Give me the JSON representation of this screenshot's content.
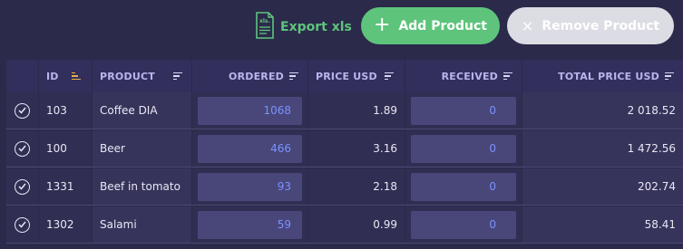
{
  "toolbar": {
    "export_label": "Export xls",
    "export_icon": "xls-file-icon",
    "export_icon_text": "xls.",
    "add_label": "Add Product",
    "add_icon": "+",
    "remove_label": "Remove Product",
    "remove_icon": "×"
  },
  "colors": {
    "background": "#2b2a4a",
    "accent_green": "#5ec47c",
    "disabled_button": "#dcdce4",
    "input_value": "#7a92ff",
    "sort_active": "#e5b04a"
  },
  "table": {
    "headers": {
      "id": "ID",
      "product": "PRODUCT",
      "ordered": "ORDERED",
      "price_usd": "PRICE USD",
      "received": "RECEIVED",
      "total_price_usd": "TOTAL PRICE USD"
    },
    "rows": [
      {
        "id": "103",
        "product": "Coffee DIA",
        "ordered": "1068",
        "price_usd": "1.89",
        "received": "0",
        "total_price_usd": "2 018.52"
      },
      {
        "id": "100",
        "product": "Beer",
        "ordered": "466",
        "price_usd": "3.16",
        "received": "0",
        "total_price_usd": "1 472.56"
      },
      {
        "id": "1331",
        "product": "Beef in tomato",
        "ordered": "93",
        "price_usd": "2.18",
        "received": "0",
        "total_price_usd": "202.74"
      },
      {
        "id": "1302",
        "product": "Salami",
        "ordered": "59",
        "price_usd": "0.99",
        "received": "0",
        "total_price_usd": "58.41"
      }
    ]
  }
}
